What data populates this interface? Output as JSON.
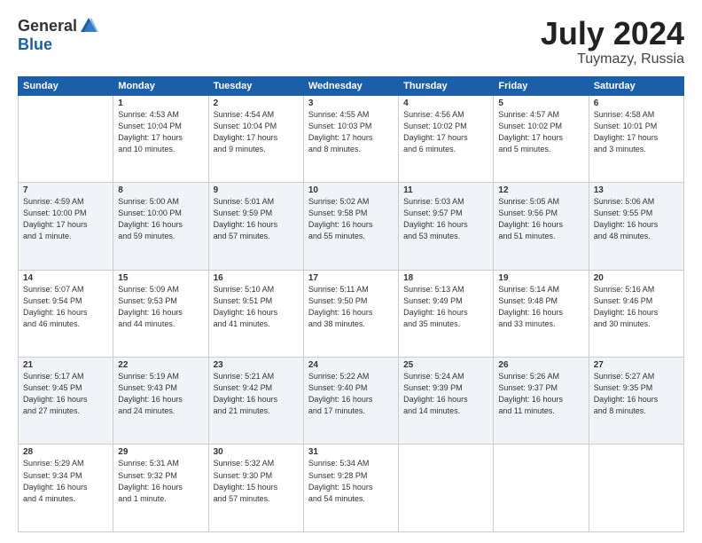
{
  "header": {
    "logo_general": "General",
    "logo_blue": "Blue",
    "title": "July 2024",
    "location": "Tuymazy, Russia"
  },
  "weekdays": [
    "Sunday",
    "Monday",
    "Tuesday",
    "Wednesday",
    "Thursday",
    "Friday",
    "Saturday"
  ],
  "weeks": [
    [
      {
        "day": "",
        "detail": ""
      },
      {
        "day": "1",
        "detail": "Sunrise: 4:53 AM\nSunset: 10:04 PM\nDaylight: 17 hours\nand 10 minutes."
      },
      {
        "day": "2",
        "detail": "Sunrise: 4:54 AM\nSunset: 10:04 PM\nDaylight: 17 hours\nand 9 minutes."
      },
      {
        "day": "3",
        "detail": "Sunrise: 4:55 AM\nSunset: 10:03 PM\nDaylight: 17 hours\nand 8 minutes."
      },
      {
        "day": "4",
        "detail": "Sunrise: 4:56 AM\nSunset: 10:02 PM\nDaylight: 17 hours\nand 6 minutes."
      },
      {
        "day": "5",
        "detail": "Sunrise: 4:57 AM\nSunset: 10:02 PM\nDaylight: 17 hours\nand 5 minutes."
      },
      {
        "day": "6",
        "detail": "Sunrise: 4:58 AM\nSunset: 10:01 PM\nDaylight: 17 hours\nand 3 minutes."
      }
    ],
    [
      {
        "day": "7",
        "detail": "Sunrise: 4:59 AM\nSunset: 10:00 PM\nDaylight: 17 hours\nand 1 minute."
      },
      {
        "day": "8",
        "detail": "Sunrise: 5:00 AM\nSunset: 10:00 PM\nDaylight: 16 hours\nand 59 minutes."
      },
      {
        "day": "9",
        "detail": "Sunrise: 5:01 AM\nSunset: 9:59 PM\nDaylight: 16 hours\nand 57 minutes."
      },
      {
        "day": "10",
        "detail": "Sunrise: 5:02 AM\nSunset: 9:58 PM\nDaylight: 16 hours\nand 55 minutes."
      },
      {
        "day": "11",
        "detail": "Sunrise: 5:03 AM\nSunset: 9:57 PM\nDaylight: 16 hours\nand 53 minutes."
      },
      {
        "day": "12",
        "detail": "Sunrise: 5:05 AM\nSunset: 9:56 PM\nDaylight: 16 hours\nand 51 minutes."
      },
      {
        "day": "13",
        "detail": "Sunrise: 5:06 AM\nSunset: 9:55 PM\nDaylight: 16 hours\nand 48 minutes."
      }
    ],
    [
      {
        "day": "14",
        "detail": "Sunrise: 5:07 AM\nSunset: 9:54 PM\nDaylight: 16 hours\nand 46 minutes."
      },
      {
        "day": "15",
        "detail": "Sunrise: 5:09 AM\nSunset: 9:53 PM\nDaylight: 16 hours\nand 44 minutes."
      },
      {
        "day": "16",
        "detail": "Sunrise: 5:10 AM\nSunset: 9:51 PM\nDaylight: 16 hours\nand 41 minutes."
      },
      {
        "day": "17",
        "detail": "Sunrise: 5:11 AM\nSunset: 9:50 PM\nDaylight: 16 hours\nand 38 minutes."
      },
      {
        "day": "18",
        "detail": "Sunrise: 5:13 AM\nSunset: 9:49 PM\nDaylight: 16 hours\nand 35 minutes."
      },
      {
        "day": "19",
        "detail": "Sunrise: 5:14 AM\nSunset: 9:48 PM\nDaylight: 16 hours\nand 33 minutes."
      },
      {
        "day": "20",
        "detail": "Sunrise: 5:16 AM\nSunset: 9:46 PM\nDaylight: 16 hours\nand 30 minutes."
      }
    ],
    [
      {
        "day": "21",
        "detail": "Sunrise: 5:17 AM\nSunset: 9:45 PM\nDaylight: 16 hours\nand 27 minutes."
      },
      {
        "day": "22",
        "detail": "Sunrise: 5:19 AM\nSunset: 9:43 PM\nDaylight: 16 hours\nand 24 minutes."
      },
      {
        "day": "23",
        "detail": "Sunrise: 5:21 AM\nSunset: 9:42 PM\nDaylight: 16 hours\nand 21 minutes."
      },
      {
        "day": "24",
        "detail": "Sunrise: 5:22 AM\nSunset: 9:40 PM\nDaylight: 16 hours\nand 17 minutes."
      },
      {
        "day": "25",
        "detail": "Sunrise: 5:24 AM\nSunset: 9:39 PM\nDaylight: 16 hours\nand 14 minutes."
      },
      {
        "day": "26",
        "detail": "Sunrise: 5:26 AM\nSunset: 9:37 PM\nDaylight: 16 hours\nand 11 minutes."
      },
      {
        "day": "27",
        "detail": "Sunrise: 5:27 AM\nSunset: 9:35 PM\nDaylight: 16 hours\nand 8 minutes."
      }
    ],
    [
      {
        "day": "28",
        "detail": "Sunrise: 5:29 AM\nSunset: 9:34 PM\nDaylight: 16 hours\nand 4 minutes."
      },
      {
        "day": "29",
        "detail": "Sunrise: 5:31 AM\nSunset: 9:32 PM\nDaylight: 16 hours\nand 1 minute."
      },
      {
        "day": "30",
        "detail": "Sunrise: 5:32 AM\nSunset: 9:30 PM\nDaylight: 15 hours\nand 57 minutes."
      },
      {
        "day": "31",
        "detail": "Sunrise: 5:34 AM\nSunset: 9:28 PM\nDaylight: 15 hours\nand 54 minutes."
      },
      {
        "day": "",
        "detail": ""
      },
      {
        "day": "",
        "detail": ""
      },
      {
        "day": "",
        "detail": ""
      }
    ]
  ]
}
